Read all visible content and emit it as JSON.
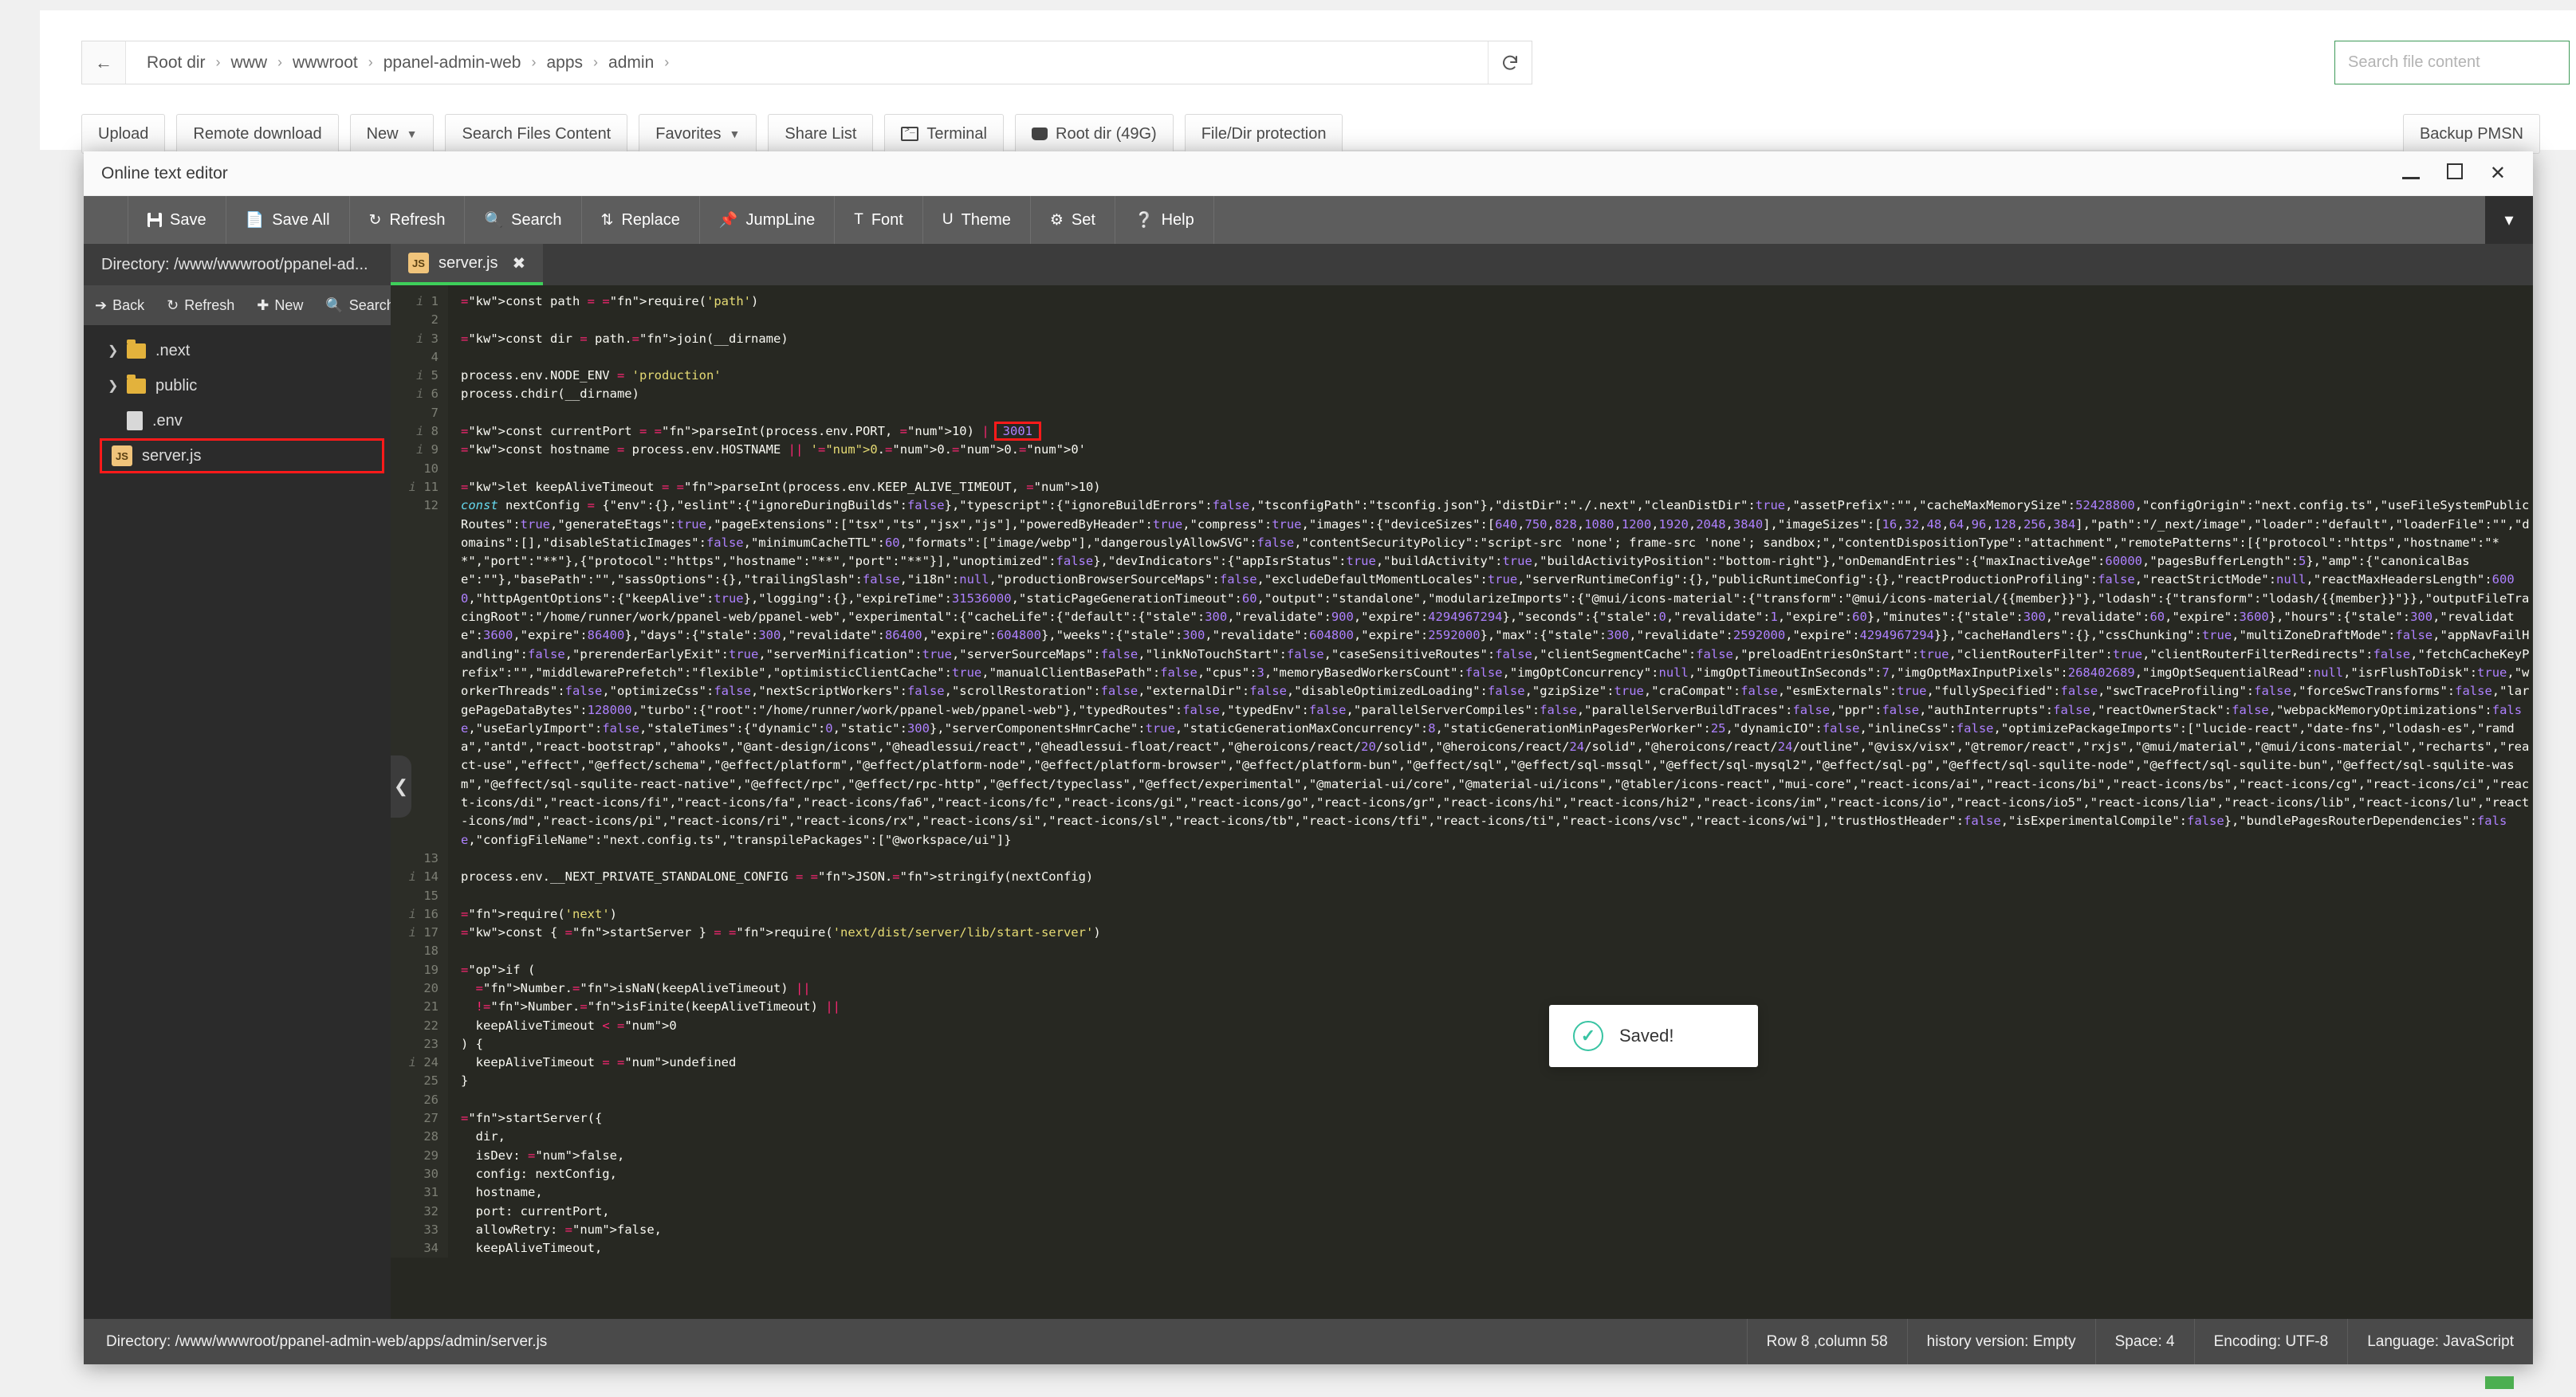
{
  "breadcrumb": {
    "back_icon": "arrow-left-icon",
    "segments": [
      "Root dir",
      "www",
      "wwwroot",
      "ppanel-admin-web",
      "apps",
      "admin"
    ],
    "separator": "›",
    "trailing_separator": "›",
    "refresh_icon": "refresh-icon"
  },
  "search_files": {
    "placeholder": "Search file content"
  },
  "toolbar": {
    "buttons": [
      {
        "label": "Upload",
        "caret": false,
        "icon": null
      },
      {
        "label": "Remote download",
        "caret": false,
        "icon": null
      },
      {
        "label": "New",
        "caret": true,
        "icon": null
      },
      {
        "label": "Search Files Content",
        "caret": false,
        "icon": null
      },
      {
        "label": "Favorites",
        "caret": true,
        "icon": null
      },
      {
        "label": "Share List",
        "caret": false,
        "icon": null
      },
      {
        "label": "Terminal",
        "caret": false,
        "icon": "terminal-icon"
      },
      {
        "label": "Root dir (49G)",
        "caret": false,
        "icon": "disk-icon"
      },
      {
        "label": "File/Dir protection",
        "caret": false,
        "icon": null
      }
    ],
    "backup_label": "Backup PMSN"
  },
  "editor": {
    "title": "Online text editor",
    "window_controls": {
      "minimize": "minimize-icon",
      "maximize": "maximize-icon",
      "close": "close-icon"
    },
    "menu": [
      {
        "label": "Save",
        "icon": "floppy-icon"
      },
      {
        "label": "Save All",
        "icon": "save-all-icon"
      },
      {
        "label": "Refresh",
        "icon": "refresh-icon"
      },
      {
        "label": "Search",
        "icon": "magnifier-icon"
      },
      {
        "label": "Replace",
        "icon": "replace-icon"
      },
      {
        "label": "JumpLine",
        "icon": "pin-icon"
      },
      {
        "label": "Font",
        "icon": "text-size-icon"
      },
      {
        "label": "Theme",
        "icon": "magnet-icon"
      },
      {
        "label": "Set",
        "icon": "gear-icon"
      },
      {
        "label": "Help",
        "icon": "question-icon"
      }
    ],
    "menu_collapse_icon": "chevron-down-icon",
    "sidebar": {
      "directory_label": "Directory: /www/wwwroot/ppanel-ad...",
      "tools": [
        {
          "label": "Back",
          "icon": "arrow-right-icon"
        },
        {
          "label": "Refresh",
          "icon": "refresh-icon"
        },
        {
          "label": "New",
          "icon": "plus-icon"
        },
        {
          "label": "Search",
          "icon": "magnifier-icon"
        }
      ],
      "tree": [
        {
          "name": ".next",
          "type": "folder",
          "expandable": true,
          "selected": false,
          "icon": "folder-icon"
        },
        {
          "name": "public",
          "type": "folder",
          "expandable": true,
          "selected": false,
          "icon": "folder-icon"
        },
        {
          "name": ".env",
          "type": "file",
          "expandable": false,
          "selected": false,
          "icon": "file-icon"
        },
        {
          "name": "server.js",
          "type": "file",
          "expandable": false,
          "selected": true,
          "icon": "js-file-icon"
        }
      ]
    },
    "tabs": [
      {
        "label": "server.js",
        "icon": "js-file-icon",
        "close_icon": "close-icon",
        "active": true
      }
    ],
    "collapse_handle_icon": "chevron-left-icon",
    "toast": {
      "message": "Saved!",
      "icon": "check-circle-icon"
    },
    "status": {
      "directory": "Directory: /www/wwwroot/ppanel-admin-web/apps/admin/server.js",
      "items": [
        "Row 8 ,column 58",
        "history version: Empty",
        "Space: 4",
        "Encoding: UTF-8",
        "Language: JavaScript"
      ]
    },
    "highlighted_value": "3001",
    "code_lines": [
      {
        "n": 1,
        "info": true,
        "text": "const path = require('path')"
      },
      {
        "n": 2,
        "info": false,
        "text": ""
      },
      {
        "n": 3,
        "info": true,
        "text": "const dir = path.join(__dirname)"
      },
      {
        "n": 4,
        "info": false,
        "text": ""
      },
      {
        "n": 5,
        "info": true,
        "text": "process.env.NODE_ENV = 'production'"
      },
      {
        "n": 6,
        "info": true,
        "text": "process.chdir(__dirname)"
      },
      {
        "n": 7,
        "info": false,
        "text": ""
      },
      {
        "n": 8,
        "info": true,
        "text": "const currentPort = parseInt(process.env.PORT, 10) | 3001"
      },
      {
        "n": 9,
        "info": true,
        "text": "const hostname = process.env.HOSTNAME || '0.0.0.0'"
      },
      {
        "n": 10,
        "info": false,
        "text": ""
      },
      {
        "n": 11,
        "info": true,
        "text": "let keepAliveTimeout = parseInt(process.env.KEEP_ALIVE_TIMEOUT, 10)"
      },
      {
        "n": 12,
        "info": false,
        "text": "const nextConfig = {\"env\":{},\"eslint\":{\"ignoreDuringBuilds\":false},\"typescript\":{\"ignoreBuildErrors\":false,\"tsconfigPath\":\"tsconfig.json\"},\"distDir\":\"./.next\",\"cleanDistDir\":true,\"assetPrefix\":\"\",\"cacheMaxMemorySize\":52428800,\"configOrigin\":\"next.config.ts\",\"useFileSystemPublicRoutes\":true,\"generateEtags\":true,\"pageExtensions\":[\"tsx\",\"ts\",\"jsx\",\"js\"],\"poweredByHeader\":true,\"compress\":true,\"images\":{\"deviceSizes\":[640,750,828,1080,1200,1920,2048,3840],\"imageSizes\":[16,32,48,64,96,128,256,384],\"path\":\"/_next/image\",\"loader\":\"default\",\"loaderFile\":\"\",\"domains\":[],\"disableStaticImages\":false,\"minimumCacheTTL\":60,\"formats\":[\"image/webp\"],\"dangerouslyAllowSVG\":false,\"contentSecurityPolicy\":\"script-src 'none'; frame-src 'none'; sandbox;\",\"contentDispositionType\":\"attachment\",\"remotePatterns\":[{\"protocol\":\"https\",\"hostname\":\"**\",\"port\":\"**\"},{\"protocol\":\"https\",\"hostname\":\"**\",\"port\":\"**\"}],\"unoptimized\":false},\"devIndicators\":{\"appIsrStatus\":true,\"buildActivity\":true,\"buildActivityPosition\":\"bottom-right\"},\"onDemandEntries\":{\"maxInactiveAge\":60000,\"pagesBufferLength\":5},\"amp\":{\"canonicalBase\":\"\"},\"basePath\":\"\",\"sassOptions\":{},\"trailingSlash\":false,\"i18n\":null,\"productionBrowserSourceMaps\":false,\"excludeDefaultMomentLocales\":true,\"serverRuntimeConfig\":{},\"publicRuntimeConfig\":{},\"reactProductionProfiling\":false,\"reactStrictMode\":null,\"reactMaxHeadersLength\":6000,\"httpAgentOptions\":{\"keepAlive\":true},\"logging\":{},\"expireTime\":31536000,\"staticPageGenerationTimeout\":60,\"output\":\"standalone\",\"modularizeImports\":{\"@mui/icons-material\":{\"transform\":\"@mui/icons-material/{{member}}\"},\"lodash\":{\"transform\":\"lodash/{{member}}\"}},\"outputFileTracingRoot\":\"/home/runner/work/ppanel-web/ppanel-web\",\"experimental\":{\"cacheLife\":{\"default\":{\"stale\":300,\"revalidate\":900,\"expire\":4294967294},\"seconds\":{\"stale\":0,\"revalidate\":1,\"expire\":60},\"minutes\":{\"stale\":300,\"revalidate\":60,\"expire\":3600},\"hours\":{\"stale\":300,\"revalidate\":3600,\"expire\":86400},\"days\":{\"stale\":300,\"revalidate\":86400,\"expire\":604800},\"weeks\":{\"stale\":300,\"revalidate\":604800,\"expire\":2592000},\"max\":{\"stale\":300,\"revalidate\":2592000,\"expire\":4294967294}},\"cacheHandlers\":{},\"cssChunking\":true,\"multiZoneDraftMode\":false,\"appNavFailHandling\":false,\"prerenderEarlyExit\":true,\"serverMinification\":true,\"serverSourceMaps\":false,\"linkNoTouchStart\":false,\"caseSensitiveRoutes\":false,\"clientSegmentCache\":false,\"preloadEntriesOnStart\":true,\"clientRouterFilter\":true,\"clientRouterFilterRedirects\":false,\"fetchCacheKeyPrefix\":\"\",\"middlewarePrefetch\":\"flexible\",\"optimisticClientCache\":true,\"manualClientBasePath\":false,\"cpus\":3,\"memoryBasedWorkersCount\":false,\"imgOptConcurrency\":null,\"imgOptTimeoutInSeconds\":7,\"imgOptMaxInputPixels\":268402689,\"imgOptSequentialRead\":null,\"isrFlushToDisk\":true,\"workerThreads\":false,\"optimizeCss\":false,\"nextScriptWorkers\":false,\"scrollRestoration\":false,\"externalDir\":false,\"disableOptimizedLoading\":false,\"gzipSize\":true,\"craCompat\":false,\"esmExternals\":true,\"fullySpecified\":false,\"swcTraceProfiling\":false,\"forceSwcTransforms\":false,\"largePageDataBytes\":128000,\"turbo\":{\"root\":\"/home/runner/work/ppanel-web/ppanel-web\"},\"typedRoutes\":false,\"typedEnv\":false,\"parallelServerCompiles\":false,\"parallelServerBuildTraces\":false,\"ppr\":false,\"authInterrupts\":false,\"reactOwnerStack\":false,\"webpackMemoryOptimizations\":false,\"useEarlyImport\":false,\"staleTimes\":{\"dynamic\":0,\"static\":300},\"serverComponentsHmrCache\":true,\"staticGenerationMaxConcurrency\":8,\"staticGenerationMinPagesPerWorker\":25,\"dynamicIO\":false,\"inlineCss\":false,\"optimizePackageImports\":[\"lucide-react\",\"date-fns\",\"lodash-es\",\"ramda\",\"antd\",\"react-bootstrap\",\"ahooks\",\"@ant-design/icons\",\"@headlessui/react\",\"@headlessui-float/react\",\"@heroicons/react/20/solid\",\"@heroicons/react/24/solid\",\"@heroicons/react/24/outline\",\"@visx/visx\",\"@tremor/react\",\"rxjs\",\"@mui/material\",\"@mui/icons-material\",\"recharts\",\"react-use\",\"effect\",\"@effect/schema\",\"@effect/platform\",\"@effect/platform-node\",\"@effect/platform-browser\",\"@effect/platform-bun\",\"@effect/sql\",\"@effect/sql-mssql\",\"@effect/sql-mysql2\",\"@effect/sql-pg\",\"@effect/sql-squlite-node\",\"@effect/sql-squlite-bun\",\"@effect/sql-squlite-wasm\",\"@effect/sql-squlite-react-native\",\"@effect/rpc\",\"@effect/rpc-http\",\"@effect/typeclass\",\"@effect/experimental\",\"@material-ui/core\",\"@material-ui/icons\",\"@tabler/icons-react\",\"mui-core\",\"react-icons/ai\",\"react-icons/bi\",\"react-icons/bs\",\"react-icons/cg\",\"react-icons/ci\",\"react-icons/di\",\"react-icons/fi\",\"react-icons/fa\",\"react-icons/fa6\",\"react-icons/fc\",\"react-icons/gi\",\"react-icons/go\",\"react-icons/gr\",\"react-icons/hi\",\"react-icons/hi2\",\"react-icons/im\",\"react-icons/io\",\"react-icons/io5\",\"react-icons/lia\",\"react-icons/lib\",\"react-icons/lu\",\"react-icons/md\",\"react-icons/pi\",\"react-icons/ri\",\"react-icons/rx\",\"react-icons/si\",\"react-icons/sl\",\"react-icons/tb\",\"react-icons/tfi\",\"react-icons/ti\",\"react-icons/vsc\",\"react-icons/wi\"],\"trustHostHeader\":false,\"isExperimentalCompile\":false},\"bundlePagesRouterDependencies\":false,\"configFileName\":\"next.config.ts\",\"transpilePackages\":[\"@workspace/ui\"]}"
      },
      {
        "n": 13,
        "info": false,
        "text": ""
      },
      {
        "n": 14,
        "info": true,
        "text": "process.env.__NEXT_PRIVATE_STANDALONE_CONFIG = JSON.stringify(nextConfig)"
      },
      {
        "n": 15,
        "info": false,
        "text": ""
      },
      {
        "n": 16,
        "info": true,
        "text": "require('next')"
      },
      {
        "n": 17,
        "info": true,
        "text": "const { startServer } = require('next/dist/server/lib/start-server')"
      },
      {
        "n": 18,
        "info": false,
        "text": ""
      },
      {
        "n": 19,
        "info": false,
        "text": "if ("
      },
      {
        "n": 20,
        "info": false,
        "text": "  Number.isNaN(keepAliveTimeout) ||"
      },
      {
        "n": 21,
        "info": false,
        "text": "  !Number.isFinite(keepAliveTimeout) ||"
      },
      {
        "n": 22,
        "info": false,
        "text": "  keepAliveTimeout < 0"
      },
      {
        "n": 23,
        "info": false,
        "text": ") {"
      },
      {
        "n": 24,
        "info": true,
        "text": "  keepAliveTimeout = undefined"
      },
      {
        "n": 25,
        "info": false,
        "text": "}"
      },
      {
        "n": 26,
        "info": false,
        "text": ""
      },
      {
        "n": 27,
        "info": false,
        "text": "startServer({"
      },
      {
        "n": 28,
        "info": false,
        "text": "  dir,"
      },
      {
        "n": 29,
        "info": false,
        "text": "  isDev: false,"
      },
      {
        "n": 30,
        "info": false,
        "text": "  config: nextConfig,"
      },
      {
        "n": 31,
        "info": false,
        "text": "  hostname,"
      },
      {
        "n": 32,
        "info": false,
        "text": "  port: currentPort,"
      },
      {
        "n": 33,
        "info": false,
        "text": "  allowRetry: false,"
      },
      {
        "n": 34,
        "info": false,
        "text": "  keepAliveTimeout,"
      }
    ]
  },
  "colors": {
    "accent_green": "#3ecf5a",
    "highlight_red": "#ff1a1a",
    "toast_check": "#39c4a3",
    "editor_bg": "#272822",
    "chrome_bg": "#3c3c3c"
  }
}
